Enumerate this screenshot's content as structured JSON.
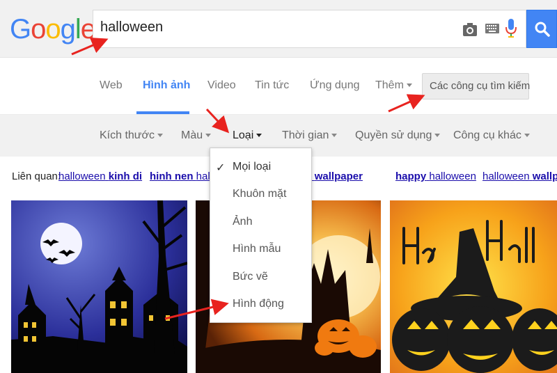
{
  "logo": {
    "text": "Google"
  },
  "search": {
    "query": "halloween"
  },
  "tabs": [
    {
      "label": "Web"
    },
    {
      "label": "Hình ảnh"
    },
    {
      "label": "Video"
    },
    {
      "label": "Tin tức"
    },
    {
      "label": "Ứng dụng"
    },
    {
      "label": "Thêm"
    }
  ],
  "tools_button": "Các công cụ tìm kiếm",
  "filters": [
    {
      "label": "Kích thước"
    },
    {
      "label": "Màu"
    },
    {
      "label": "Loại"
    },
    {
      "label": "Thời gian"
    },
    {
      "label": "Quyền sử dụng"
    },
    {
      "label": "Công cụ khác"
    }
  ],
  "related": {
    "label": "Liên quan:",
    "links": [
      {
        "plain": "halloween",
        "bold": "kinh di"
      },
      {
        "plain": "",
        "bold": "hinh nen",
        "tail": "halloween"
      },
      {
        "plain": "halloween",
        "bold": "wallpaper"
      },
      {
        "plain": "",
        "bold": "happy",
        "tail": "halloween"
      },
      {
        "plain": "halloween",
        "bold": "wallpaper"
      }
    ]
  },
  "dropdown": {
    "items": [
      {
        "label": "Mọi loại",
        "checked": true
      },
      {
        "label": "Khuôn mặt"
      },
      {
        "label": "Ảnh"
      },
      {
        "label": "Hình mẫu"
      },
      {
        "label": "Bức vẽ"
      },
      {
        "label": "Hình động"
      }
    ],
    "check_glyph": "✓"
  },
  "images": [
    {
      "name": "halloween-haunted-house"
    },
    {
      "name": "halloween-castle-pumpkins"
    },
    {
      "name": "happy-halloween-witch-hat"
    }
  ],
  "colors": {
    "accent": "#4285f4",
    "link": "#1a0dab",
    "annotation": "#e8231f"
  }
}
